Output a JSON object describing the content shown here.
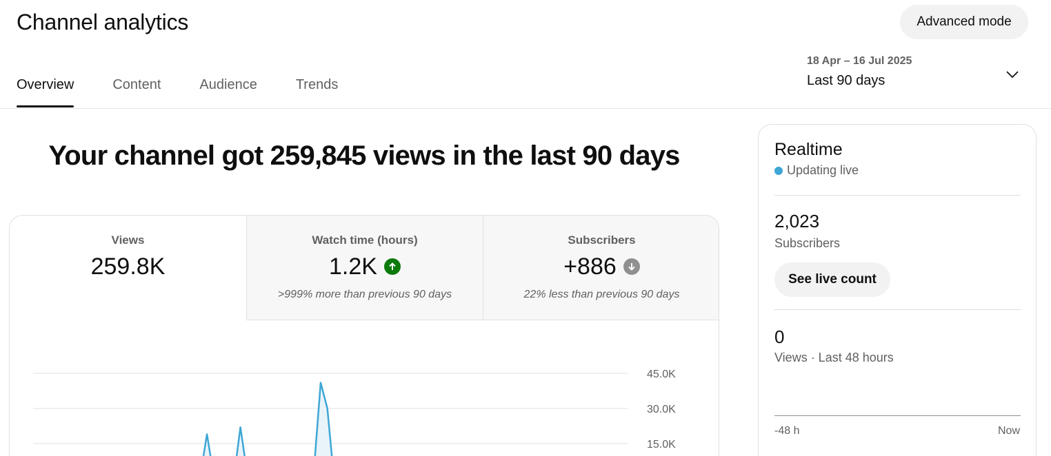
{
  "header": {
    "title": "Channel analytics",
    "advanced_mode_label": "Advanced mode"
  },
  "tabs": [
    {
      "label": "Overview",
      "active": true
    },
    {
      "label": "Content",
      "active": false
    },
    {
      "label": "Audience",
      "active": false
    },
    {
      "label": "Trends",
      "active": false
    }
  ],
  "date_picker": {
    "range": "18 Apr – 16 Jul 2025",
    "label": "Last 90 days",
    "icon": "chevron-down-icon"
  },
  "summary": {
    "headline": "Your channel got 259,845 views in the last 90 days"
  },
  "metrics": [
    {
      "label": "Views",
      "value": "259.8K",
      "trend": "",
      "comparison": ""
    },
    {
      "label": "Watch time (hours)",
      "value": "1.2K",
      "trend": "up",
      "comparison": ">999% more than previous 90 days"
    },
    {
      "label": "Subscribers",
      "value": "+886",
      "trend": "down",
      "comparison": "22% less than previous 90 days"
    }
  ],
  "colors": {
    "accent": "#3ea6d6",
    "trend_up": "#0b7a0b",
    "trend_down": "#909090",
    "chart_fill": "#e8f4fa"
  },
  "chart_data": {
    "type": "area",
    "yticks": [
      "45.0K",
      "30.0K",
      "15.0K"
    ],
    "ylim": [
      0,
      45000
    ],
    "series": [
      {
        "values": [
          0,
          0,
          0,
          0,
          0,
          0,
          0,
          0,
          0,
          1500,
          2500,
          0,
          0,
          0,
          0,
          0,
          0,
          0,
          0,
          0,
          0,
          0,
          0,
          0,
          0,
          1200,
          19000,
          1500,
          0,
          0,
          0,
          22000,
          2500,
          0,
          3500,
          2500,
          0,
          0,
          0,
          0,
          0,
          2000,
          4000,
          41000,
          30000,
          0,
          0,
          0,
          0,
          0,
          0,
          0,
          0,
          0,
          0,
          0,
          0,
          0,
          0,
          0,
          0,
          0,
          0,
          0,
          0,
          0,
          0,
          0,
          0,
          0,
          0,
          0,
          0,
          0,
          0,
          0,
          0,
          0,
          0,
          0,
          0,
          0,
          0,
          0,
          0,
          0,
          0,
          0,
          0,
          0
        ]
      }
    ]
  },
  "realtime": {
    "title": "Realtime",
    "live_label": "Updating live",
    "subscribers_value": "2,023",
    "subscribers_label": "Subscribers",
    "live_count_button": "See live count",
    "views_value": "0",
    "views_label": "Views · Last 48 hours",
    "axis_start": "-48 h",
    "axis_end": "Now"
  }
}
